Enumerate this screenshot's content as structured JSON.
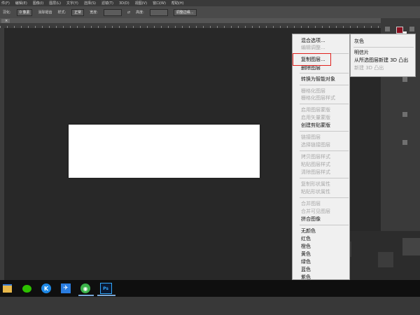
{
  "menubar": {
    "items": [
      "件(F)",
      "编辑(E)",
      "图像(I)",
      "图层(L)",
      "文字(Y)",
      "选择(S)",
      "滤镜(T)",
      "3D(D)",
      "视图(V)",
      "窗口(W)",
      "帮助(H)"
    ]
  },
  "options": {
    "feather_label": "羽化:",
    "feather_value": "0 像素",
    "antialias_label": "消除锯齿",
    "style_label": "样式:",
    "style_value": "正常",
    "width_label": "宽度:",
    "height_label": "高度:",
    "refine_label": "调整边缘..."
  },
  "document_tab": {
    "label": "",
    "close": "×"
  },
  "context_menu": {
    "items": [
      {
        "label": "混合选项...",
        "enabled": true
      },
      {
        "label": "编辑调整...",
        "enabled": false
      },
      {
        "label": "复制图层...",
        "enabled": true
      },
      {
        "label": "删除图层",
        "enabled": true
      },
      {
        "label": "转换为智能对象",
        "enabled": true
      },
      {
        "label": "栅格化图层",
        "enabled": false
      },
      {
        "label": "栅格化图层样式",
        "enabled": false
      },
      {
        "label": "启用图层蒙版",
        "enabled": false
      },
      {
        "label": "启用矢量蒙版",
        "enabled": false
      },
      {
        "label": "创建剪贴蒙版",
        "enabled": true
      },
      {
        "label": "链接图层",
        "enabled": false
      },
      {
        "label": "选择链接图层",
        "enabled": false
      },
      {
        "label": "拷贝图层样式",
        "enabled": false
      },
      {
        "label": "粘贴图层样式",
        "enabled": false
      },
      {
        "label": "清除图层样式",
        "enabled": false
      },
      {
        "label": "复制形状属性",
        "enabled": false
      },
      {
        "label": "粘贴形状属性",
        "enabled": false
      },
      {
        "label": "合并图层",
        "enabled": false
      },
      {
        "label": "合并可见图层",
        "enabled": false
      },
      {
        "label": "拼合图像",
        "enabled": true
      },
      {
        "label": "无颜色",
        "enabled": true
      },
      {
        "label": "红色",
        "enabled": true
      },
      {
        "label": "橙色",
        "enabled": true
      },
      {
        "label": "黄色",
        "enabled": true
      },
      {
        "label": "绿色",
        "enabled": true
      },
      {
        "label": "蓝色",
        "enabled": true
      },
      {
        "label": "紫色",
        "enabled": true
      }
    ]
  },
  "submenu": {
    "items": [
      {
        "label": "灰色",
        "enabled": true
      },
      {
        "label": "明信片",
        "enabled": true
      },
      {
        "label": "从所选图层新建 3D 凸出",
        "enabled": true
      },
      {
        "label": "新建 3D 凸出",
        "enabled": false
      }
    ]
  },
  "taskbar": {
    "apps": [
      {
        "icon": "file-explorer-icon",
        "glyph": "▬"
      },
      {
        "icon": "wechat-icon",
        "glyph": "●"
      },
      {
        "icon": "kugou-icon",
        "glyph": "K"
      },
      {
        "icon": "feishu-icon",
        "glyph": "✈"
      },
      {
        "icon": "green-app-icon",
        "glyph": "◉"
      },
      {
        "icon": "photoshop-icon",
        "glyph": "Ps"
      }
    ]
  },
  "colors": {
    "highlight_box": "#e0201c",
    "foreground_swatch": "#8a1020"
  }
}
